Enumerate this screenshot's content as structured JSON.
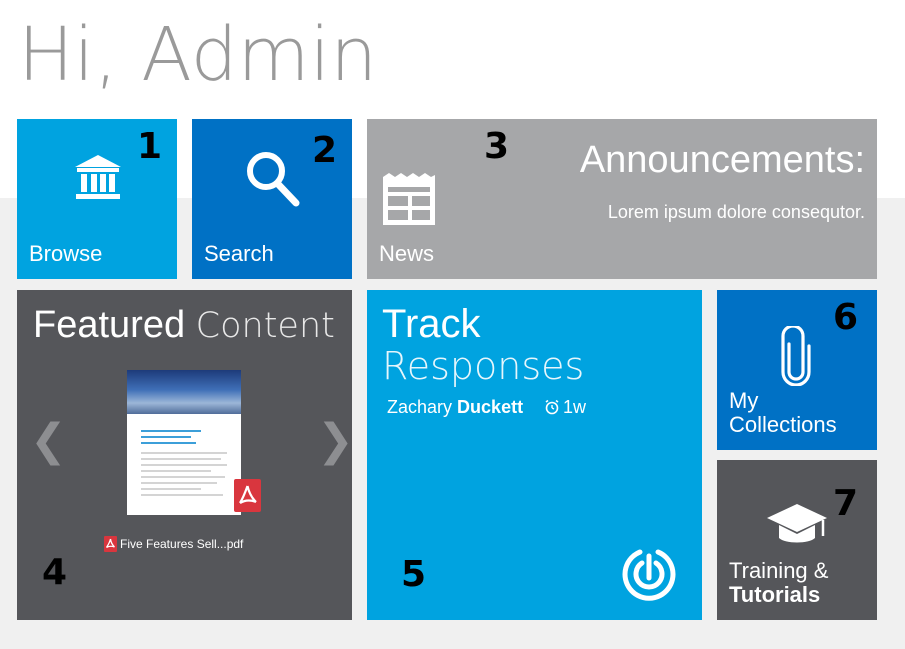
{
  "greeting": "Hi, Admin",
  "tiles": {
    "browse": {
      "label": "Browse",
      "number": "1"
    },
    "search": {
      "label": "Search",
      "number": "2"
    },
    "news": {
      "label": "News",
      "number": "3",
      "title": "Announcements:",
      "text": "Lorem ipsum dolore consequtor."
    },
    "featured": {
      "title_bold": "Featured",
      "title_light": "Content",
      "number": "4",
      "file_name": "Five Features Sell...pdf",
      "prev_arrow": "❮",
      "next_arrow": "❯"
    },
    "track": {
      "title": "Track",
      "subtitle": "Responses",
      "number": "5",
      "user_first": "Zachary",
      "user_last": "Duckett",
      "age": "1w"
    },
    "collections": {
      "line1": "My",
      "line2": "Collections",
      "number": "6"
    },
    "training": {
      "line1": "Training &",
      "line2": "Tutorials",
      "number": "7"
    }
  },
  "icons": {
    "browse": "bank-icon",
    "search": "search-icon",
    "news": "newspaper-icon",
    "pdf": "pdf-icon",
    "clock": "alarm-clock-icon",
    "radar": "radar-icon",
    "collections": "paperclip-icon",
    "training": "graduation-cap-icon"
  },
  "colors": {
    "light_blue": "#00a3e0",
    "dark_blue": "#0071c5",
    "gray": "#a6a7a9",
    "charcoal": "#55565a",
    "pdf_red": "#d9363e"
  }
}
